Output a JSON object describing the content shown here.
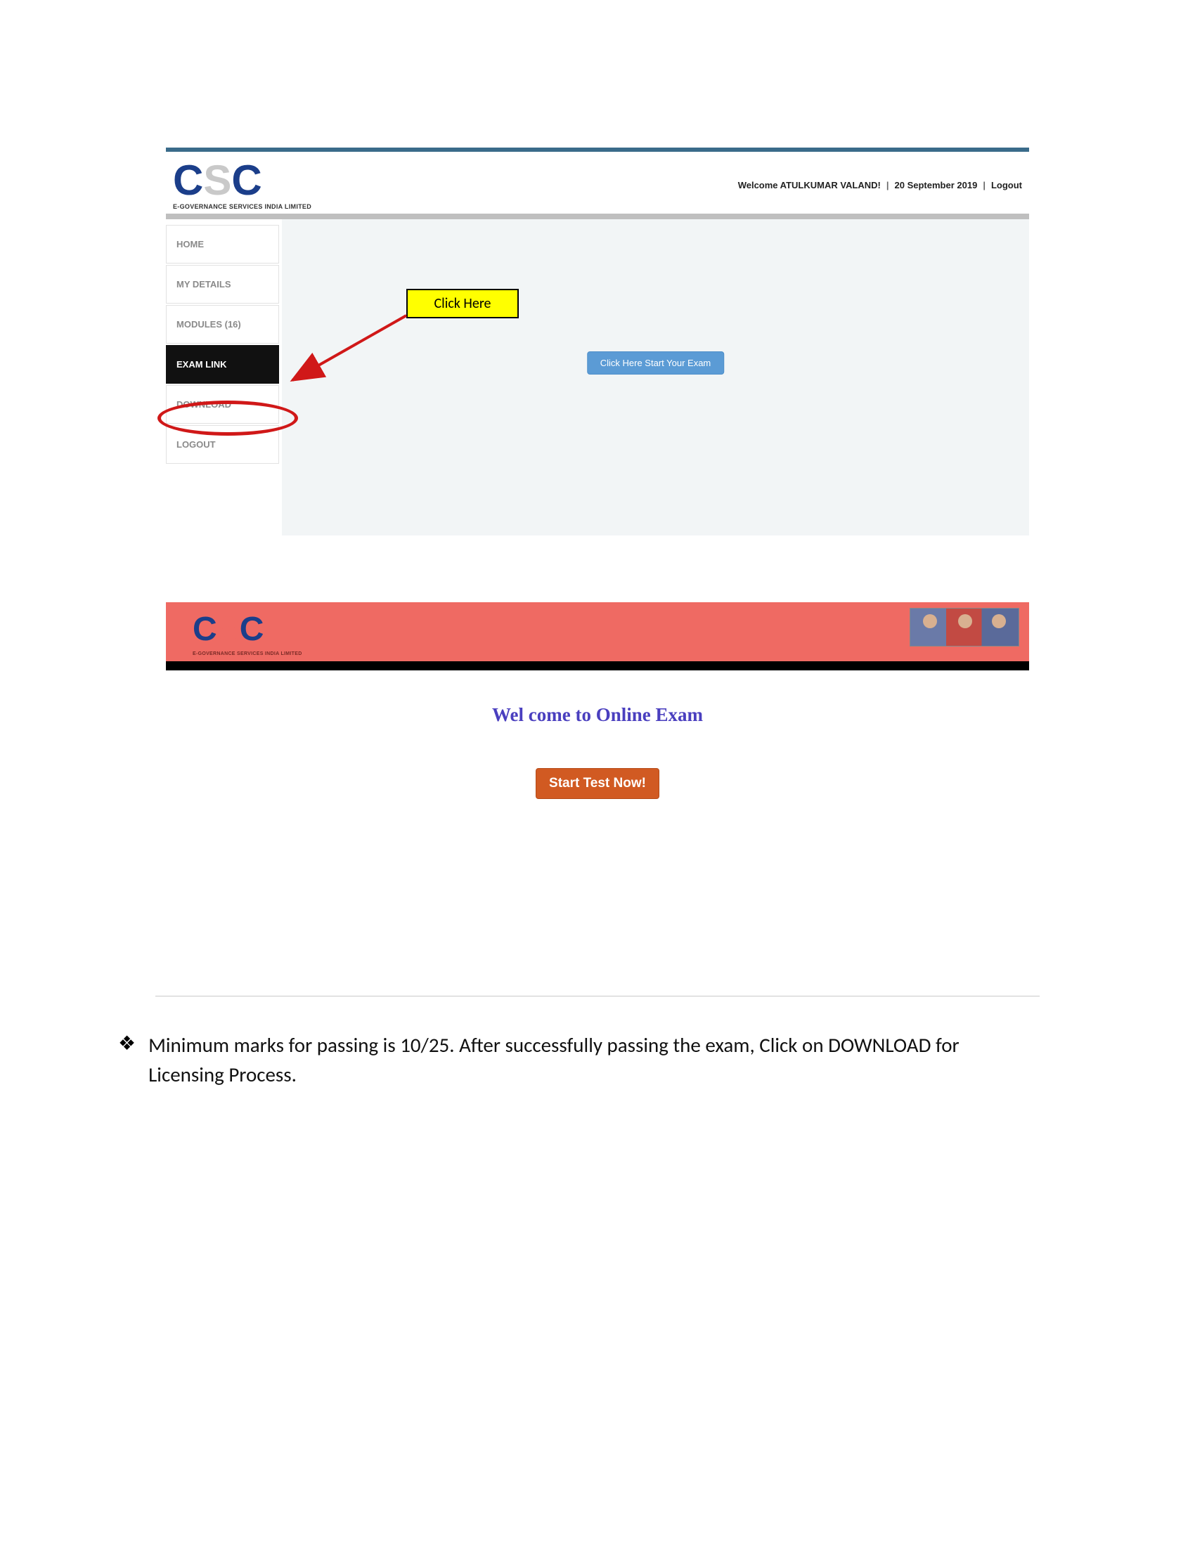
{
  "shot1": {
    "logo_tag": "E-GOVERNANCE SERVICES INDIA LIMITED",
    "header": {
      "welcome": "Welcome ATULKUMAR VALAND!",
      "date": "20 September 2019",
      "logout": "Logout"
    },
    "sidebar": {
      "home": "HOME",
      "my_details": "MY DETAILS",
      "modules": "MODULES (16)",
      "exam_link": "EXAM LINK",
      "download": "DOWNLOAD",
      "logout": "LOGOUT"
    },
    "main": {
      "start_exam_btn": "Click Here Start Your Exam"
    },
    "callout": "Click Here"
  },
  "shot2": {
    "logo_tag": "E-GOVERNANCE SERVICES INDIA LIMITED",
    "title": "Wel come to Online Exam",
    "start_btn": "Start Test Now!"
  },
  "bullet": {
    "text": "Minimum marks for passing is 10/25. After successfully passing the exam, Click on DOWNLOAD for Licensing Process."
  }
}
